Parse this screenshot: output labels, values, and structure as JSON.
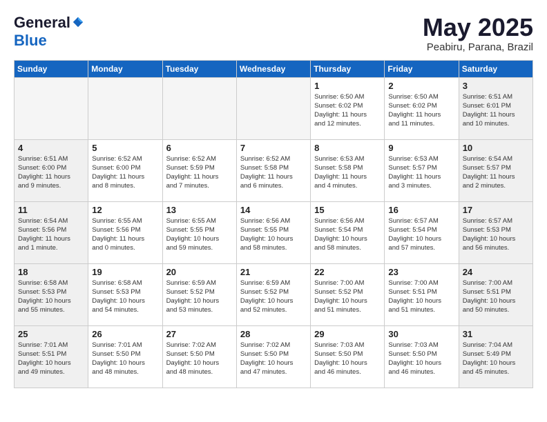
{
  "logo": {
    "general": "General",
    "blue": "Blue"
  },
  "header": {
    "month": "May 2025",
    "location": "Peabiru, Parana, Brazil"
  },
  "weekdays": [
    "Sunday",
    "Monday",
    "Tuesday",
    "Wednesday",
    "Thursday",
    "Friday",
    "Saturday"
  ],
  "weeks": [
    [
      {
        "day": "",
        "info": ""
      },
      {
        "day": "",
        "info": ""
      },
      {
        "day": "",
        "info": ""
      },
      {
        "day": "",
        "info": ""
      },
      {
        "day": "1",
        "info": "Sunrise: 6:50 AM\nSunset: 6:02 PM\nDaylight: 11 hours\nand 12 minutes."
      },
      {
        "day": "2",
        "info": "Sunrise: 6:50 AM\nSunset: 6:02 PM\nDaylight: 11 hours\nand 11 minutes."
      },
      {
        "day": "3",
        "info": "Sunrise: 6:51 AM\nSunset: 6:01 PM\nDaylight: 11 hours\nand 10 minutes."
      }
    ],
    [
      {
        "day": "4",
        "info": "Sunrise: 6:51 AM\nSunset: 6:00 PM\nDaylight: 11 hours\nand 9 minutes."
      },
      {
        "day": "5",
        "info": "Sunrise: 6:52 AM\nSunset: 6:00 PM\nDaylight: 11 hours\nand 8 minutes."
      },
      {
        "day": "6",
        "info": "Sunrise: 6:52 AM\nSunset: 5:59 PM\nDaylight: 11 hours\nand 7 minutes."
      },
      {
        "day": "7",
        "info": "Sunrise: 6:52 AM\nSunset: 5:58 PM\nDaylight: 11 hours\nand 6 minutes."
      },
      {
        "day": "8",
        "info": "Sunrise: 6:53 AM\nSunset: 5:58 PM\nDaylight: 11 hours\nand 4 minutes."
      },
      {
        "day": "9",
        "info": "Sunrise: 6:53 AM\nSunset: 5:57 PM\nDaylight: 11 hours\nand 3 minutes."
      },
      {
        "day": "10",
        "info": "Sunrise: 6:54 AM\nSunset: 5:57 PM\nDaylight: 11 hours\nand 2 minutes."
      }
    ],
    [
      {
        "day": "11",
        "info": "Sunrise: 6:54 AM\nSunset: 5:56 PM\nDaylight: 11 hours\nand 1 minute."
      },
      {
        "day": "12",
        "info": "Sunrise: 6:55 AM\nSunset: 5:56 PM\nDaylight: 11 hours\nand 0 minutes."
      },
      {
        "day": "13",
        "info": "Sunrise: 6:55 AM\nSunset: 5:55 PM\nDaylight: 10 hours\nand 59 minutes."
      },
      {
        "day": "14",
        "info": "Sunrise: 6:56 AM\nSunset: 5:55 PM\nDaylight: 10 hours\nand 58 minutes."
      },
      {
        "day": "15",
        "info": "Sunrise: 6:56 AM\nSunset: 5:54 PM\nDaylight: 10 hours\nand 58 minutes."
      },
      {
        "day": "16",
        "info": "Sunrise: 6:57 AM\nSunset: 5:54 PM\nDaylight: 10 hours\nand 57 minutes."
      },
      {
        "day": "17",
        "info": "Sunrise: 6:57 AM\nSunset: 5:53 PM\nDaylight: 10 hours\nand 56 minutes."
      }
    ],
    [
      {
        "day": "18",
        "info": "Sunrise: 6:58 AM\nSunset: 5:53 PM\nDaylight: 10 hours\nand 55 minutes."
      },
      {
        "day": "19",
        "info": "Sunrise: 6:58 AM\nSunset: 5:53 PM\nDaylight: 10 hours\nand 54 minutes."
      },
      {
        "day": "20",
        "info": "Sunrise: 6:59 AM\nSunset: 5:52 PM\nDaylight: 10 hours\nand 53 minutes."
      },
      {
        "day": "21",
        "info": "Sunrise: 6:59 AM\nSunset: 5:52 PM\nDaylight: 10 hours\nand 52 minutes."
      },
      {
        "day": "22",
        "info": "Sunrise: 7:00 AM\nSunset: 5:52 PM\nDaylight: 10 hours\nand 51 minutes."
      },
      {
        "day": "23",
        "info": "Sunrise: 7:00 AM\nSunset: 5:51 PM\nDaylight: 10 hours\nand 51 minutes."
      },
      {
        "day": "24",
        "info": "Sunrise: 7:00 AM\nSunset: 5:51 PM\nDaylight: 10 hours\nand 50 minutes."
      }
    ],
    [
      {
        "day": "25",
        "info": "Sunrise: 7:01 AM\nSunset: 5:51 PM\nDaylight: 10 hours\nand 49 minutes."
      },
      {
        "day": "26",
        "info": "Sunrise: 7:01 AM\nSunset: 5:50 PM\nDaylight: 10 hours\nand 48 minutes."
      },
      {
        "day": "27",
        "info": "Sunrise: 7:02 AM\nSunset: 5:50 PM\nDaylight: 10 hours\nand 48 minutes."
      },
      {
        "day": "28",
        "info": "Sunrise: 7:02 AM\nSunset: 5:50 PM\nDaylight: 10 hours\nand 47 minutes."
      },
      {
        "day": "29",
        "info": "Sunrise: 7:03 AM\nSunset: 5:50 PM\nDaylight: 10 hours\nand 46 minutes."
      },
      {
        "day": "30",
        "info": "Sunrise: 7:03 AM\nSunset: 5:50 PM\nDaylight: 10 hours\nand 46 minutes."
      },
      {
        "day": "31",
        "info": "Sunrise: 7:04 AM\nSunset: 5:49 PM\nDaylight: 10 hours\nand 45 minutes."
      }
    ]
  ]
}
